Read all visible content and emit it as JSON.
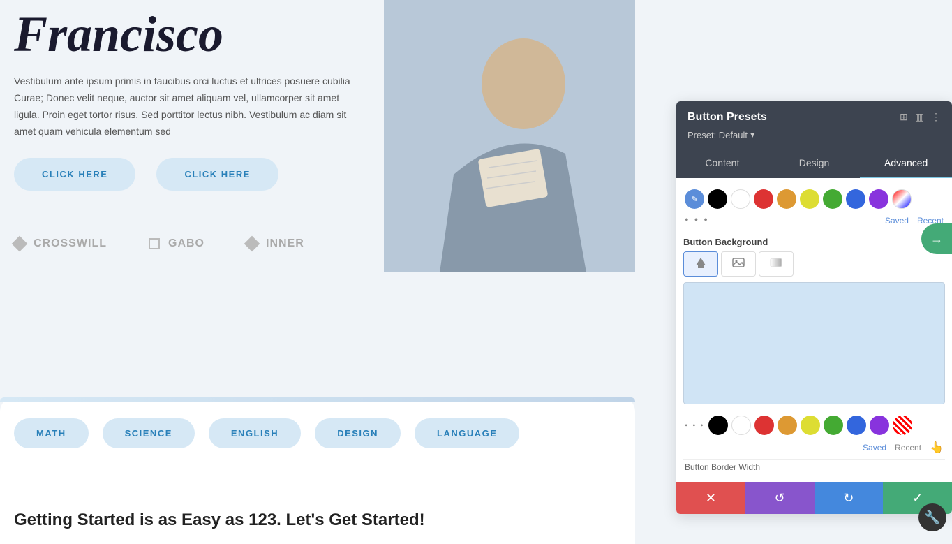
{
  "page": {
    "title": "Francisco",
    "subtitle": "Vestibulum ante ipsum primis in faucibus orci luctus et ultrices posuere cubilia Curae; Donec velit neque, auctor sit amet aliquam vel, ullamcorper sit amet ligula. Proin eget tortor risus. Sed porttitor lectus nibh. Vestibulum ac diam sit amet quam vehicula elementum sed",
    "button1": "CLICK HERE",
    "button2": "CLICK HERE",
    "getting_started": "Getting Started is as Easy as 123. Let's Get Started!"
  },
  "logos": [
    {
      "name": "CROSSWILL",
      "symbol": "◇"
    },
    {
      "name": "GABO",
      "symbol": "□"
    },
    {
      "name": "INNER",
      "symbol": "◇"
    }
  ],
  "tags": [
    {
      "label": "MATH"
    },
    {
      "label": "SCIENCE"
    },
    {
      "label": "ENGLISH"
    },
    {
      "label": "DESIGN"
    },
    {
      "label": "LANGUAGE"
    }
  ],
  "panel": {
    "title": "Button Presets",
    "preset_label": "Preset: Default",
    "tabs": [
      {
        "label": "Content",
        "active": false
      },
      {
        "label": "Design",
        "active": false
      },
      {
        "label": "Advanced",
        "active": true
      }
    ],
    "saved_label": "Saved",
    "recent_label": "Recent",
    "bg_section_label": "Button Background",
    "bottom_bar": {
      "cancel_icon": "✕",
      "undo_icon": "↺",
      "redo_icon": "↻",
      "check_icon": "✓"
    }
  },
  "colors": {
    "black": "#000000",
    "white": "#ffffff",
    "red": "#dd3333",
    "orange": "#dd9933",
    "yellow": "#dddd33",
    "green": "#44aa33",
    "blue": "#3366dd",
    "purple": "#8833dd",
    "transparent": "transparent"
  },
  "icons": {
    "edit": "✎",
    "expand": "⊞",
    "columns": "☰",
    "more": "⋮",
    "fill": "🪣",
    "image": "🖼",
    "gradient": "▦",
    "dots": "•••"
  }
}
